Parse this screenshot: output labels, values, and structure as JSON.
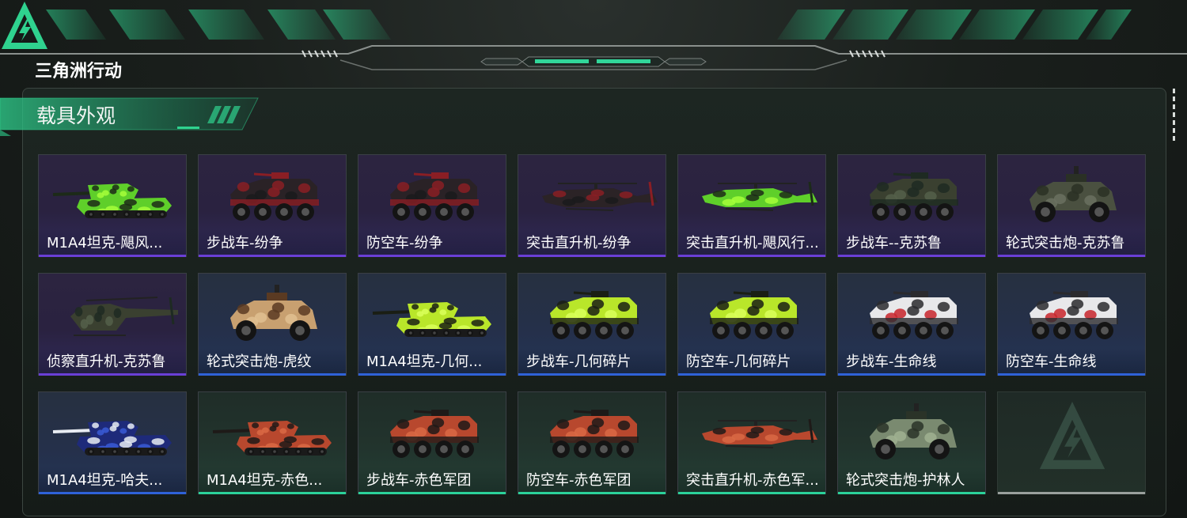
{
  "header": {
    "game_title": "三角洲行动",
    "logo_icon": "delta-triangle-logo"
  },
  "panel": {
    "title": "载具外观",
    "more_icon": "vertical-dots-icon"
  },
  "colors": {
    "accent": "#2bd29a",
    "rarity_purple": "#6a3fd6",
    "rarity_blue": "#2f62d8",
    "rarity_green": "#2bd29a",
    "empty": "#9aa09d"
  },
  "skins": [
    {
      "label": "M1A4坦克-飓风...",
      "rarity": "purple",
      "kind": "tank",
      "palette": [
        "#5fcf2a",
        "#1c2a18",
        "#a6ff3a"
      ]
    },
    {
      "label": "步战车-纷争",
      "rarity": "purple",
      "kind": "apc",
      "palette": [
        "#2a2226",
        "#8a1e24",
        "#1a1a1c"
      ]
    },
    {
      "label": "防空车-纷争",
      "rarity": "purple",
      "kind": "apc",
      "palette": [
        "#2a2226",
        "#8a1e24",
        "#1a1a1c"
      ]
    },
    {
      "label": "突击直升机-纷争",
      "rarity": "purple",
      "kind": "heli",
      "palette": [
        "#2b2326",
        "#8a1e24",
        "#1a1a1c"
      ]
    },
    {
      "label": "突击直升机-飓风行...",
      "rarity": "purple",
      "kind": "heli",
      "palette": [
        "#5fcf2a",
        "#1c2a18",
        "#a6ff3a"
      ]
    },
    {
      "label": "步战车--克苏鲁",
      "rarity": "purple",
      "kind": "apc",
      "palette": [
        "#3a4030",
        "#1e2a22",
        "#55604a"
      ]
    },
    {
      "label": "轮式突击炮-克苏鲁",
      "rarity": "purple",
      "kind": "car",
      "palette": [
        "#4a5040",
        "#2a3025",
        "#6a7060"
      ]
    },
    {
      "label": "侦察直升机-克苏鲁",
      "rarity": "purple",
      "kind": "scout",
      "palette": [
        "#3a4030",
        "#1e2a22",
        "#55604a"
      ]
    },
    {
      "label": "轮式突击炮-虎纹",
      "rarity": "blue",
      "kind": "car",
      "palette": [
        "#c8a070",
        "#5a3a22",
        "#e0c090"
      ]
    },
    {
      "label": "M1A4坦克-几何...",
      "rarity": "blue",
      "kind": "tank",
      "palette": [
        "#b9e62a",
        "#1a1e14",
        "#d9ff5a"
      ]
    },
    {
      "label": "步战车-几何碎片",
      "rarity": "blue",
      "kind": "apc",
      "palette": [
        "#b9e62a",
        "#1a1e14",
        "#d9ff5a"
      ]
    },
    {
      "label": "防空车-几何碎片",
      "rarity": "blue",
      "kind": "apc",
      "palette": [
        "#b9e62a",
        "#1a1e14",
        "#d9ff5a"
      ]
    },
    {
      "label": "步战车-生命线",
      "rarity": "blue",
      "kind": "apc",
      "palette": [
        "#e8e8ea",
        "#2a2a2e",
        "#c8242c"
      ]
    },
    {
      "label": "防空车-生命线",
      "rarity": "blue",
      "kind": "apc",
      "palette": [
        "#e8e8ea",
        "#2a2a2e",
        "#c8242c"
      ]
    },
    {
      "label": "M1A4坦克-哈夫...",
      "rarity": "blue",
      "kind": "tank",
      "palette": [
        "#1e2a7a",
        "#e8ecf2",
        "#3a5ad6"
      ]
    },
    {
      "label": "M1A4坦克-赤色...",
      "rarity": "green",
      "kind": "tank",
      "palette": [
        "#b8482e",
        "#1e1a18",
        "#d96a44"
      ]
    },
    {
      "label": "步战车-赤色军团",
      "rarity": "green",
      "kind": "apc",
      "palette": [
        "#b8482e",
        "#1e1a18",
        "#d96a44"
      ]
    },
    {
      "label": "防空车-赤色军团",
      "rarity": "green",
      "kind": "apc",
      "palette": [
        "#b8482e",
        "#1e1a18",
        "#d96a44"
      ]
    },
    {
      "label": "突击直升机-赤色军...",
      "rarity": "green",
      "kind": "heli",
      "palette": [
        "#b8482e",
        "#1e1a18",
        "#d96a44"
      ]
    },
    {
      "label": "轮式突击炮-护林人",
      "rarity": "green",
      "kind": "car",
      "palette": [
        "#7a8a70",
        "#2a3328",
        "#a0b090"
      ]
    },
    {
      "label": "",
      "rarity": "empty",
      "kind": "empty",
      "palette": []
    }
  ]
}
